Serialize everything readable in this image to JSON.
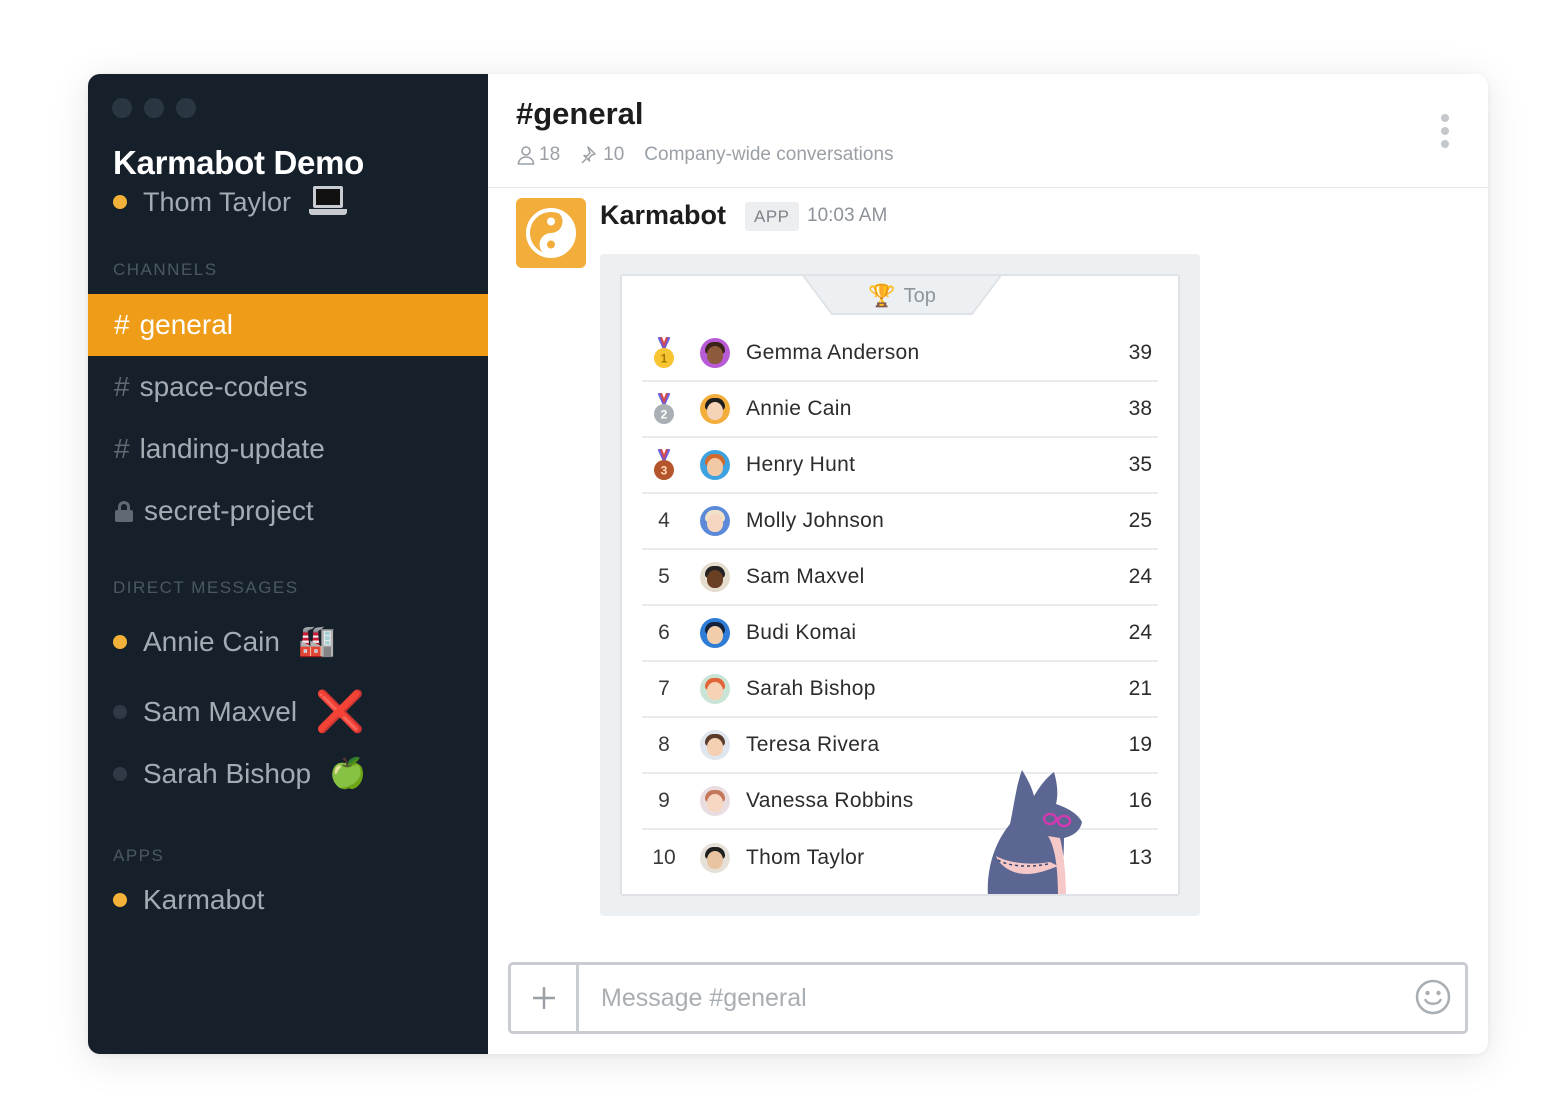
{
  "sidebar": {
    "workspace_name": "Karmabot Demo",
    "current_user": {
      "name": "Thom Taylor",
      "status": "online",
      "status_emoji": "laptop"
    },
    "channels_title": "CHANNELS",
    "channels": [
      {
        "prefix": "#",
        "label": "general",
        "active": true
      },
      {
        "prefix": "#",
        "label": "space-coders",
        "active": false
      },
      {
        "prefix": "#",
        "label": "landing-update",
        "active": false
      },
      {
        "prefix": "lock",
        "label": "secret-project",
        "active": false
      }
    ],
    "dms_title": "DIRECT MESSAGES",
    "dms": [
      {
        "label": "Annie Cain",
        "status": "online",
        "emoji": "🏭"
      },
      {
        "label": "Sam Maxvel",
        "status": "offline",
        "emoji": "❌"
      },
      {
        "label": "Sarah Bishop",
        "status": "offline",
        "emoji": "🍏"
      }
    ],
    "apps_title": "APPS",
    "apps": [
      {
        "label": "Karmabot",
        "status": "online"
      }
    ]
  },
  "channel": {
    "title": "#general",
    "members": "18",
    "pinned": "10",
    "description": "Company-wide conversations"
  },
  "message": {
    "author": "Karmabot",
    "badge": "APP",
    "time": "10:03 AM",
    "leaderboard": {
      "tab_label": "Top",
      "rows": [
        {
          "rank": "1",
          "name": "Gemma Anderson",
          "score": "39"
        },
        {
          "rank": "2",
          "name": "Annie Cain",
          "score": "38"
        },
        {
          "rank": "3",
          "name": "Henry Hunt",
          "score": "35"
        },
        {
          "rank": "4",
          "name": "Molly Johnson",
          "score": "25"
        },
        {
          "rank": "5",
          "name": "Sam Maxvel",
          "score": "24"
        },
        {
          "rank": "6",
          "name": "Budi Komai",
          "score": "24"
        },
        {
          "rank": "7",
          "name": "Sarah Bishop",
          "score": "21"
        },
        {
          "rank": "8",
          "name": "Teresa Rivera",
          "score": "19"
        },
        {
          "rank": "9",
          "name": "Vanessa Robbins",
          "score": "16"
        },
        {
          "rank": "10",
          "name": "Thom Taylor",
          "score": "13"
        }
      ]
    }
  },
  "composer": {
    "placeholder": "Message #general"
  },
  "colors": {
    "sidebar_bg": "#16202b",
    "active_channel": "#ef9c18",
    "online_dot": "#f4b13a",
    "bot_avatar": "#f2ad3b"
  }
}
